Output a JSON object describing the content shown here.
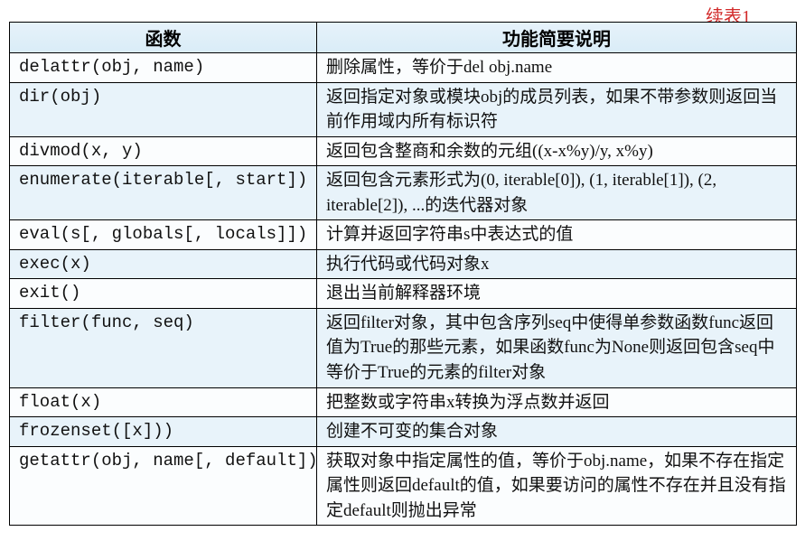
{
  "caption": "续表1",
  "headers": {
    "func": "函数",
    "desc": "功能简要说明"
  },
  "rows": [
    {
      "func": "delattr(obj, name)",
      "desc": "删除属性，等价于del obj.name",
      "shade": "light"
    },
    {
      "func": "dir(obj)",
      "desc": "返回指定对象或模块obj的成员列表，如果不带参数则返回当前作用域内所有标识符",
      "shade": "dark"
    },
    {
      "func": "divmod(x, y)",
      "desc": "返回包含整商和余数的元组((x-x%y)/y, x%y)",
      "shade": "light"
    },
    {
      "func": "enumerate(iterable[, start])",
      "desc": "返回包含元素形式为(0, iterable[0]), (1, iterable[1]), (2, iterable[2]), ...的迭代器对象",
      "shade": "dark"
    },
    {
      "func": "eval(s[, globals[, locals]])",
      "desc": "计算并返回字符串s中表达式的值",
      "shade": "light"
    },
    {
      "func": "exec(x)",
      "desc": "执行代码或代码对象x",
      "shade": "dark"
    },
    {
      "func": "exit()",
      "desc": "退出当前解释器环境",
      "shade": "light"
    },
    {
      "func": "filter(func, seq)",
      "desc": "返回filter对象，其中包含序列seq中使得单参数函数func返回值为True的那些元素，如果函数func为None则返回包含seq中等价于True的元素的filter对象",
      "shade": "dark"
    },
    {
      "func": "float(x)",
      "desc": "把整数或字符串x转换为浮点数并返回",
      "shade": "light"
    },
    {
      "func": "frozenset([x]))",
      "desc": "创建不可变的集合对象",
      "shade": "dark"
    },
    {
      "func": "getattr(obj, name[, default])",
      "desc": "获取对象中指定属性的值，等价于obj.name，如果不存在指定属性则返回default的值，如果要访问的属性不存在并且没有指定default则抛出异常",
      "shade": "light"
    }
  ],
  "watermark": ""
}
